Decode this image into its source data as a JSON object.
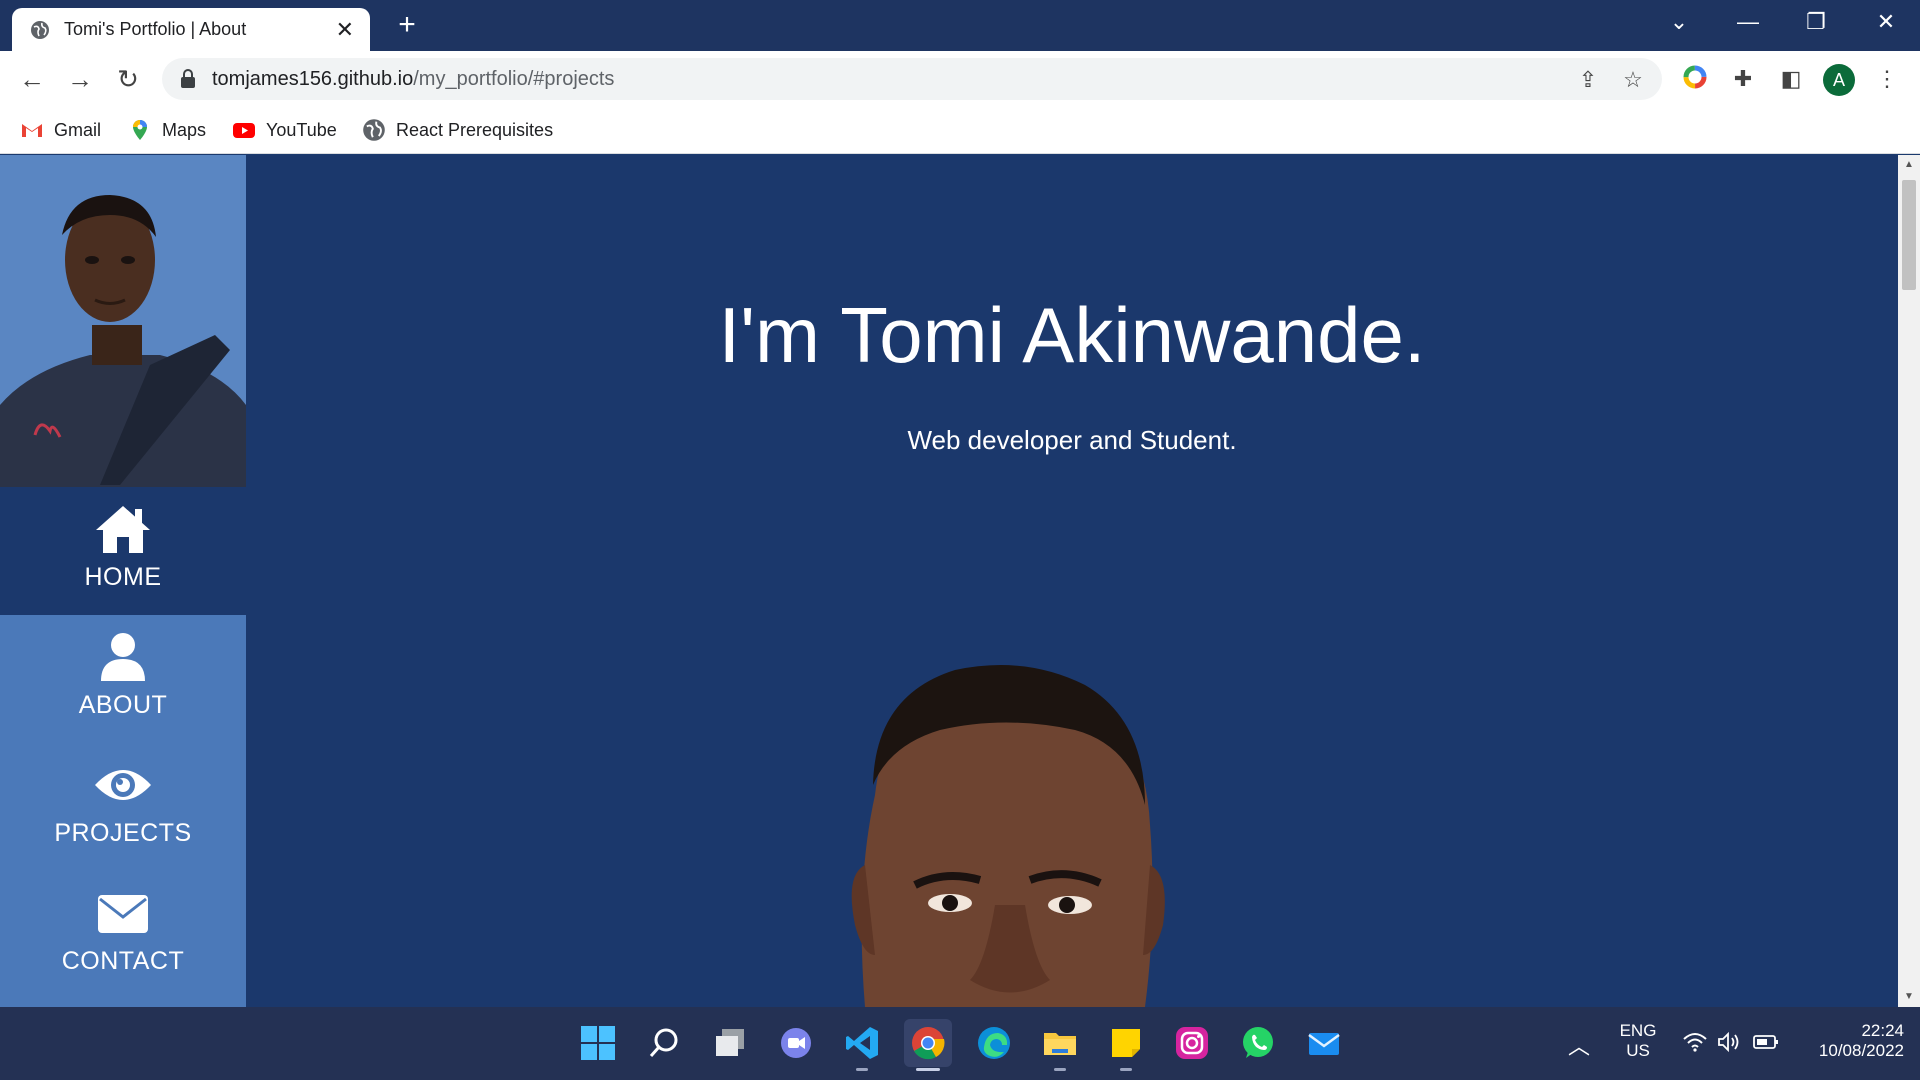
{
  "browser": {
    "tab_title": "Tomi's Portfolio | About",
    "new_tab_symbol": "+",
    "url_host": "tomjames156.github.io",
    "url_path": "/my_portfolio/#projects",
    "profile_initial": "A",
    "bookmarks": [
      {
        "label": "Gmail",
        "icon": "gmail-icon"
      },
      {
        "label": "Maps",
        "icon": "maps-icon"
      },
      {
        "label": "YouTube",
        "icon": "youtube-icon"
      },
      {
        "label": "React Prerequisites",
        "icon": "globe-icon"
      }
    ]
  },
  "sidebar": {
    "nav": [
      {
        "label": "HOME",
        "icon": "home-icon",
        "active": true
      },
      {
        "label": "ABOUT",
        "icon": "user-icon",
        "active": false
      },
      {
        "label": "PROJECTS",
        "icon": "eye-icon",
        "active": false
      },
      {
        "label": "CONTACT",
        "icon": "envelope-icon",
        "active": false
      }
    ]
  },
  "hero": {
    "title": "I'm Tomi Akinwande.",
    "subtitle": "Web developer and Student."
  },
  "taskbar": {
    "language": "ENG",
    "region": "US",
    "time": "22:24",
    "date": "10/08/2022"
  },
  "colors": {
    "page_bg": "#1b386c",
    "sidebar_bg": "#4b79b9",
    "tabbar_bg": "#1e3461",
    "taskbar_bg": "#243154"
  }
}
